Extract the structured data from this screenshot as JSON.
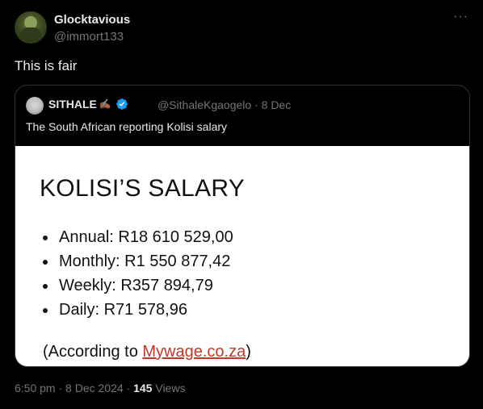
{
  "author": {
    "name": "Glocktavious",
    "handle": "@immort133"
  },
  "more_label": "···",
  "tweet": {
    "text": "This is fair"
  },
  "quoted": {
    "name": "SITHALE",
    "name_emoji": "✍🏾",
    "handle": "@SithaleKgaogelo",
    "separator": "·",
    "date": "8 Dec",
    "text": "The South African reporting Kolisi salary",
    "image": {
      "title": "KOLISI’S SALARY",
      "items": [
        "Annual: R18 610 529,00",
        "Monthly: R1 550 877,42",
        "Weekly: R357 894,79",
        "Daily: R71 578,96"
      ],
      "source_prefix": "(According to ",
      "source_link": "Mywage.co.za",
      "source_suffix": ")"
    },
    "verified_color": "#1d9bf0"
  },
  "footer": {
    "time": "6:50 pm",
    "sep": "·",
    "date": "8 Dec 2024",
    "views_count": "145",
    "views_label": "Views"
  }
}
